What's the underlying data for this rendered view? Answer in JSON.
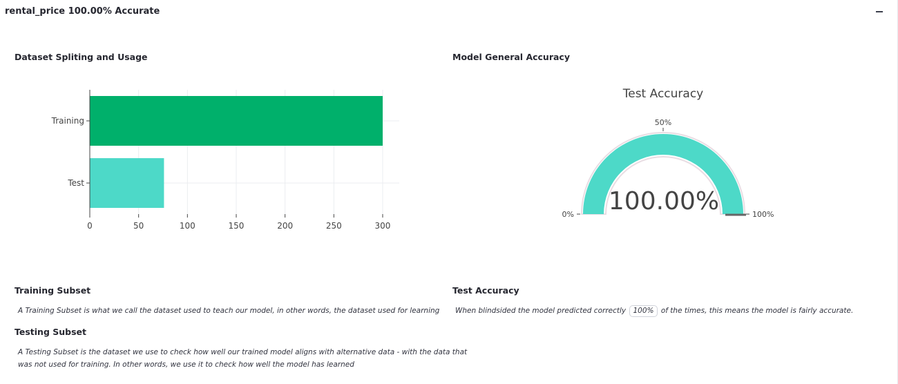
{
  "panel": {
    "title": "rental_price 100.00% Accurate",
    "collapse_icon": "minus-icon"
  },
  "left": {
    "title": "Dataset Spliting and Usage"
  },
  "right": {
    "title": "Model General Accuracy"
  },
  "chart_data": [
    {
      "type": "bar",
      "orientation": "horizontal",
      "title": "",
      "categories": [
        "Training",
        "Test"
      ],
      "values": [
        300,
        76
      ],
      "colors": [
        "#00b06b",
        "#4dd9c8"
      ],
      "xlim": [
        0,
        317
      ],
      "xticks": [
        "0",
        "50",
        "100",
        "150",
        "200",
        "250",
        "300"
      ],
      "xtick_values": [
        0,
        50,
        100,
        150,
        200,
        250,
        300
      ],
      "grid": true
    },
    {
      "type": "gauge",
      "title": "Test Accuracy",
      "value": 100,
      "value_label": "100.00%",
      "range": [
        0,
        100
      ],
      "tick_labels": [
        "0%",
        "50%",
        "100%"
      ],
      "bar_color": "#4dd9c8"
    }
  ],
  "training_subset": {
    "title": "Training Subset",
    "text": "A Training Subset is what we call the dataset used to teach our model, in other words, the dataset used for learning"
  },
  "testing_subset": {
    "title": "Testing Subset",
    "line1": "A Testing Subset is the dataset we use to check how well our trained model aligns with alternative data - with the data that",
    "line2": "was not used for training. In other words, we use it to check how well the model has learned"
  },
  "test_accuracy": {
    "title": "Test Accuracy",
    "prefix": "When blindsided the model predicted correctly",
    "value": "100%",
    "suffix": "of the times, this means the model is fairly accurate."
  }
}
